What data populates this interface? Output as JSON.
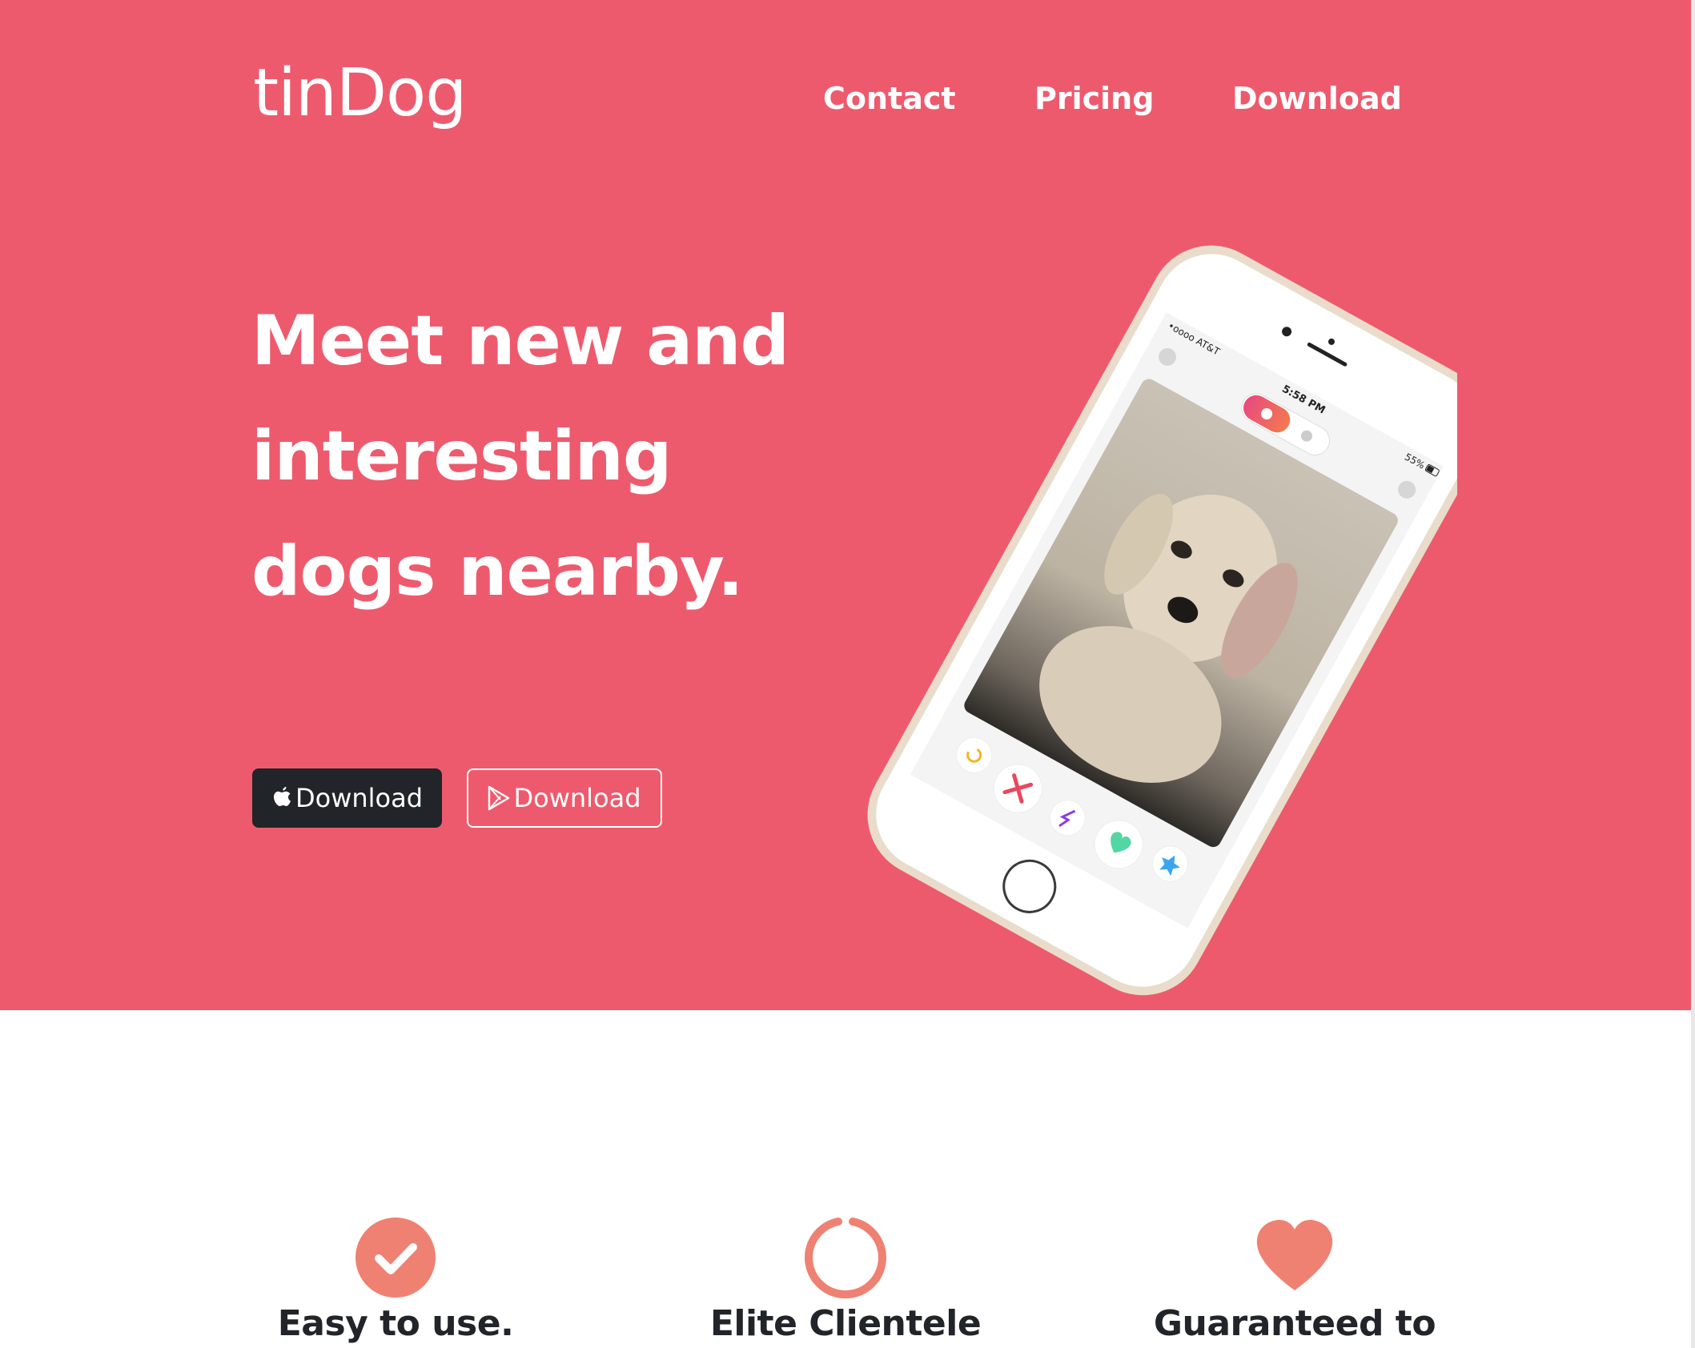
{
  "nav": {
    "brand": "tinDog",
    "links": [
      "Contact",
      "Pricing",
      "Download"
    ]
  },
  "hero": {
    "headline": "Meet new and interesting dogs nearby.",
    "buttons": {
      "apple_label": "Download",
      "google_label": "Download"
    }
  },
  "phone": {
    "carrier": "•oooo AT&T",
    "time": "5:58 PM",
    "battery": "55%"
  },
  "features": [
    {
      "icon": "check-circle-icon",
      "title": "Easy to use."
    },
    {
      "icon": "circle-notch-icon",
      "title": "Elite Clientele"
    },
    {
      "icon": "heart-icon",
      "title": "Guaranteed to"
    }
  ],
  "colors": {
    "hero_bg": "#ee5a6d",
    "accent": "#ef8172",
    "dark_button": "#212529",
    "text_dark": "#212529"
  }
}
